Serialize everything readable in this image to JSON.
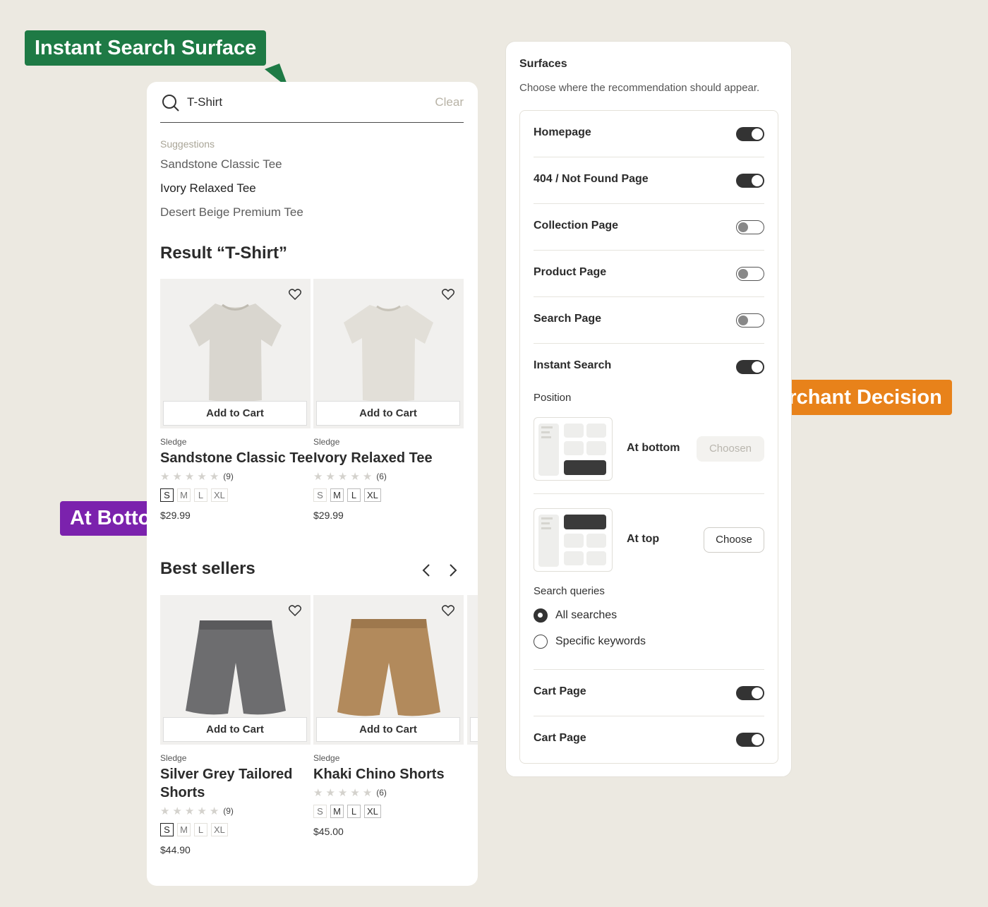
{
  "callouts": {
    "instant_search": "Instant Search Surface",
    "at_bottom": "At Bottom",
    "merchant": "Merchant Decision"
  },
  "colors": {
    "green": "#1e7a45",
    "purple": "#7b22ad",
    "orange": "#e8821a"
  },
  "search": {
    "value": "T-Shirt",
    "clear_label": "Clear",
    "suggestions_title": "Suggestions",
    "suggestions": [
      "Sandstone Classic Tee",
      "Ivory Relaxed Tee",
      "Desert Beige Premium Tee"
    ],
    "result_title": "Result “T-Shirt”"
  },
  "results": [
    {
      "brand": "Sledge",
      "name": "Sandstone Classic Tee",
      "rating_count": "(9)",
      "sizes": [
        "S",
        "M",
        "L",
        "XL"
      ],
      "selected_size": "S",
      "price": "$29.99",
      "add_label": "Add to Cart",
      "icon": "tshirt-image"
    },
    {
      "brand": "Sledge",
      "name": "Ivory Relaxed Tee",
      "rating_count": "(6)",
      "sizes": [
        "S",
        "M",
        "L",
        "XL"
      ],
      "selected_size": "",
      "price": "$29.99",
      "add_label": "Add to Cart",
      "icon": "tshirt-image"
    }
  ],
  "best_sellers": {
    "title": "Best sellers",
    "items": [
      {
        "brand": "Sledge",
        "name": "Silver Grey Tailored Shorts",
        "rating_count": "(9)",
        "sizes": [
          "S",
          "M",
          "L",
          "XL"
        ],
        "selected_size": "S",
        "price": "$44.90",
        "add_label": "Add to Cart",
        "icon": "shorts-image"
      },
      {
        "brand": "Sledge",
        "name": "Khaki Chino Shorts",
        "rating_count": "(6)",
        "sizes": [
          "S",
          "M",
          "L",
          "XL"
        ],
        "selected_size": "",
        "price": "$45.00",
        "add_label": "Add to Cart",
        "icon": "shorts-image"
      }
    ]
  },
  "surfaces": {
    "title": "Surfaces",
    "description": "Choose where the recommendation should appear.",
    "rows": [
      {
        "label": "Homepage",
        "enabled": true
      },
      {
        "label": "404 / Not Found Page",
        "enabled": true
      },
      {
        "label": "Collection Page",
        "enabled": false
      },
      {
        "label": "Product Page",
        "enabled": false
      },
      {
        "label": "Search Page",
        "enabled": false
      },
      {
        "label": "Instant Search",
        "enabled": true
      }
    ],
    "position_label": "Position",
    "positions": [
      {
        "name": "At bottom",
        "button": "Choosen",
        "chosen": true
      },
      {
        "name": "At top",
        "button": "Choose",
        "chosen": false
      }
    ],
    "queries_label": "Search queries",
    "queries": [
      {
        "label": "All searches",
        "checked": true
      },
      {
        "label": "Specific keywords",
        "checked": false
      }
    ],
    "bottom_rows": [
      {
        "label": "Cart Page",
        "enabled": true
      },
      {
        "label": "Cart Page",
        "enabled": true
      }
    ]
  }
}
